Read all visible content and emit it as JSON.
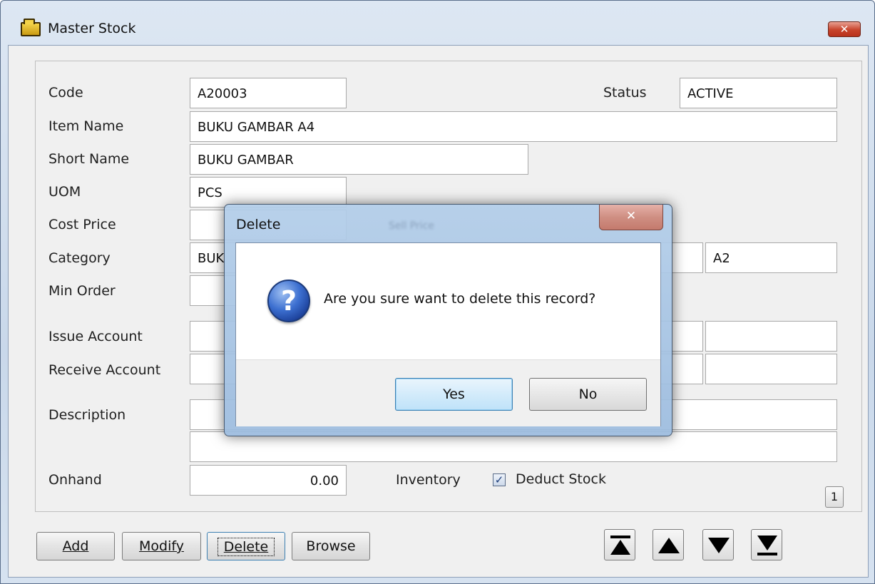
{
  "window": {
    "title": "Master Stock",
    "close_glyph": "✕",
    "accent": "#c7432b"
  },
  "form": {
    "code_label": "Code",
    "code_value": "A20003",
    "status_label": "Status",
    "status_value": "ACTIVE",
    "item_name_label": "Item Name",
    "item_name_value": "BUKU GAMBAR A4",
    "short_name_label": "Short Name",
    "short_name_value": "BUKU GAMBAR",
    "uom_label": "UOM",
    "uom_value": "PCS",
    "cost_price_label": "Cost Price",
    "cost_price_value": "",
    "category_label": "Category",
    "category_value": "BUK",
    "category_code_value": "A2",
    "min_order_label": "Min Order",
    "min_order_value": "",
    "issue_account_label": "Issue Account",
    "issue_account_value": "",
    "receive_account_label": "Receive Account",
    "receive_account_value": "",
    "description_label": "Description",
    "description_value_1": "",
    "description_value_2": "",
    "onhand_label": "Onhand",
    "onhand_value": "0.00",
    "inventory_label": "Inventory",
    "deduct_stock_label": "Deduct Stock",
    "deduct_stock_checked": true,
    "check_glyph": "✓",
    "page_number": "1"
  },
  "toolbar": {
    "add_label": "Add",
    "modify_label": "Modify",
    "delete_label": "Delete",
    "browse_label": "Browse",
    "nav": [
      "first-record-icon",
      "previous-record-icon",
      "next-record-icon",
      "last-record-icon"
    ]
  },
  "dialog": {
    "title": "Delete",
    "ghost_text": "Sell Price",
    "close_glyph": "✕",
    "icon": "question-icon",
    "icon_glyph": "?",
    "message": "Are you sure want to delete this record?",
    "yes_label": "Yes",
    "no_label": "No"
  }
}
